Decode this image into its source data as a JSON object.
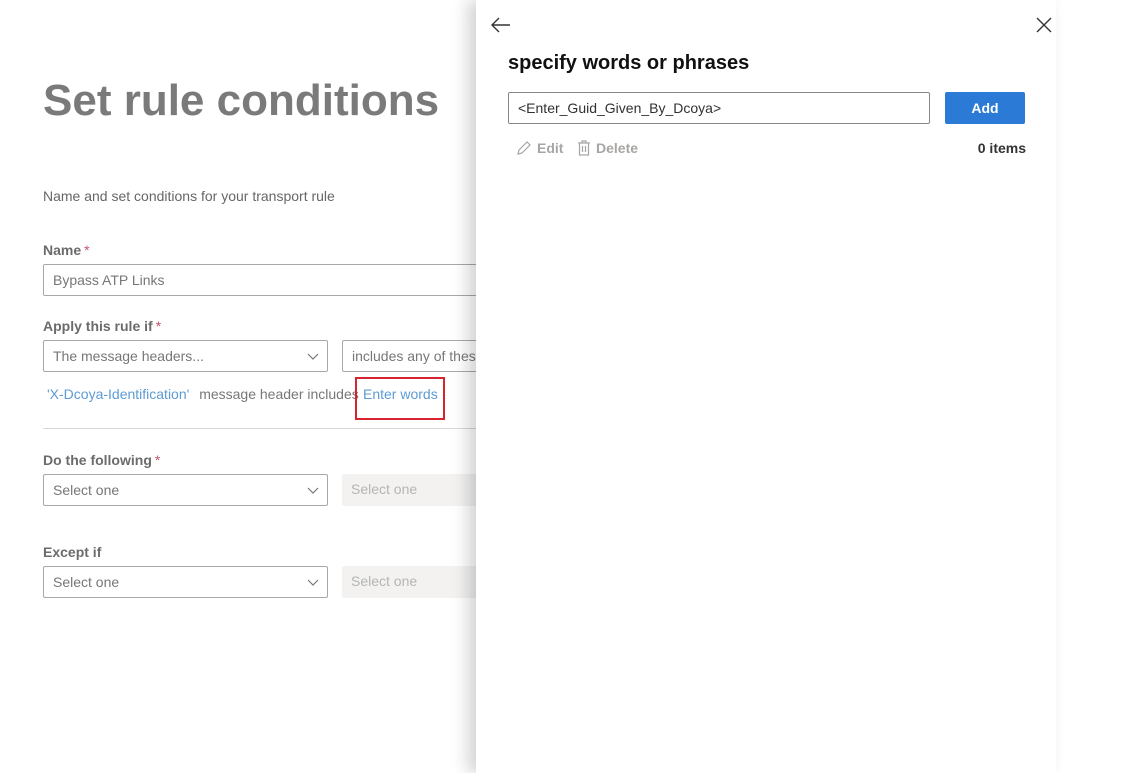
{
  "background": {
    "title": "Set rule conditions",
    "subtitle": "Name and set conditions for your transport rule",
    "name_label": "Name",
    "name_required": "*",
    "name_value": "Bypass ATP Links",
    "apply_label": "Apply this rule if",
    "apply_required": "*",
    "apply_dropdown": "The message headers...",
    "apply_dropdown2": "includes any of these",
    "condition_header": "'X-Dcoya-Identification'",
    "condition_text": "message header includes",
    "enter_words": "Enter words",
    "do_label": "Do the following",
    "do_required": "*",
    "do_dropdown": "Select one",
    "do_dropdown2": "Select one",
    "except_label": "Except if",
    "except_dropdown": "Select one",
    "except_dropdown2": "Select one"
  },
  "panel": {
    "title": "specify words or phrases",
    "input_value": "<Enter_Guid_Given_By_Dcoya>",
    "add_label": "Add",
    "edit_label": "Edit",
    "delete_label": "Delete",
    "items_count": "0 items"
  },
  "icons": {
    "back": "arrow-left-icon",
    "close": "close-icon",
    "edit": "pencil-icon",
    "delete": "trash-icon",
    "dropdown": "chevron-down-icon"
  },
  "colors": {
    "accent": "#2b7bd6",
    "link": "#5d9bd4",
    "highlight": "#d6252e",
    "required": "#c4546a"
  }
}
